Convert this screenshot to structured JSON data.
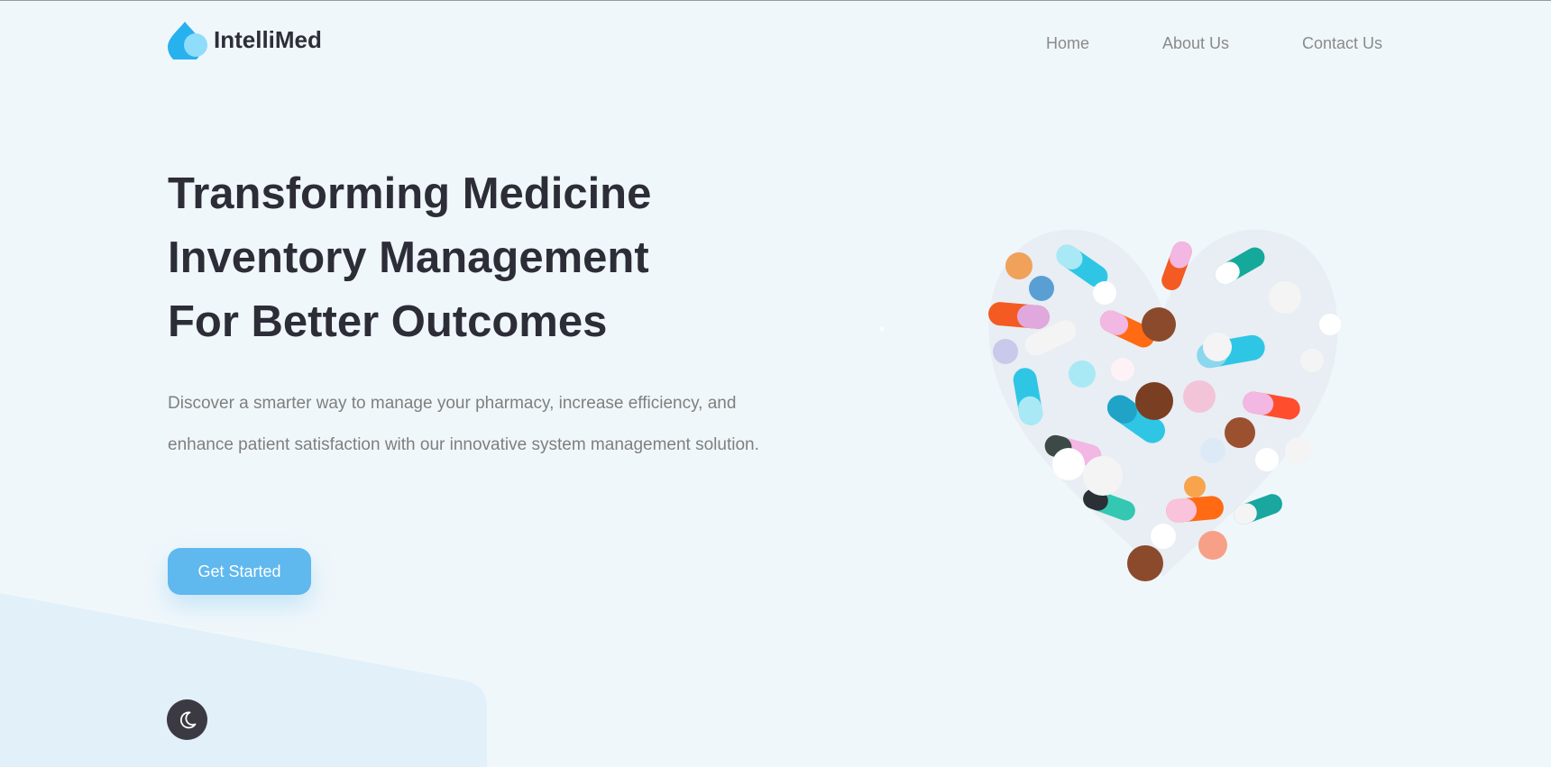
{
  "brand": {
    "name": "IntelliMed",
    "icon": "water-drop-icon",
    "accent_color": "#5fb8ee"
  },
  "nav": {
    "items": [
      {
        "label": "Home"
      },
      {
        "label": "About Us"
      },
      {
        "label": "Contact Us"
      }
    ]
  },
  "hero": {
    "title_lines": [
      "Transforming Medicine",
      "Inventory Management",
      "For Better Outcomes"
    ],
    "description": "Discover a smarter way to manage your pharmacy, increase efficiency, and enhance patient satisfaction with our innovative system management solution.",
    "cta_label": "Get Started",
    "image": "heart-of-pills-image"
  },
  "theme_toggle": {
    "icon": "moon-icon"
  }
}
